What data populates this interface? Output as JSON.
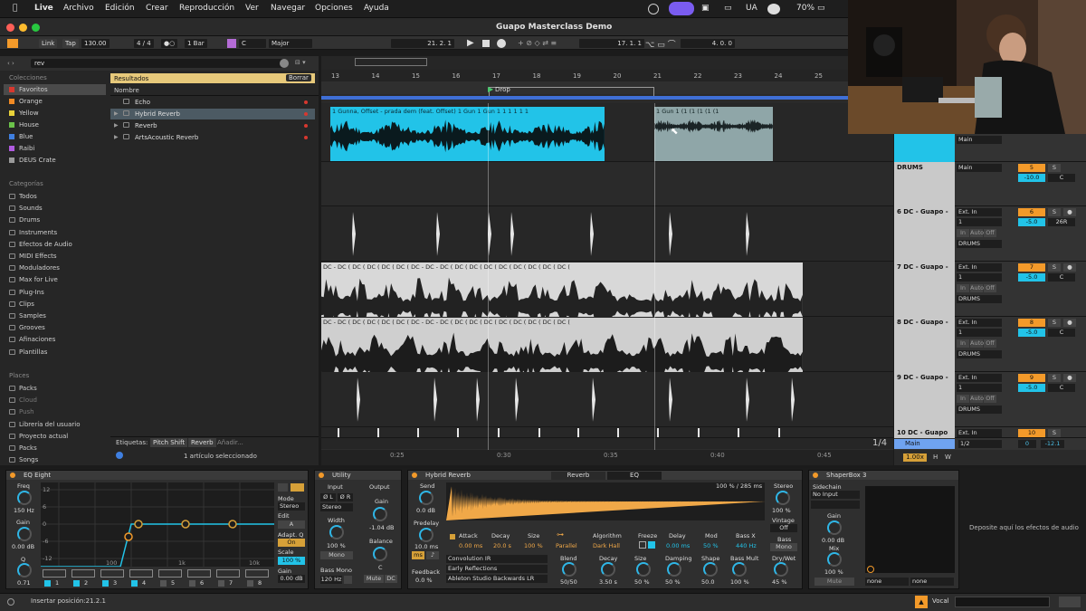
{
  "menubar": {
    "apple": "",
    "app": "Live",
    "items": [
      "Archivo",
      "Edición",
      "Crear",
      "Reproducción",
      "Ver",
      "Navegar",
      "Opciones",
      "Ayuda"
    ],
    "status": {
      "ua": "UA",
      "battery": "70%"
    }
  },
  "window": {
    "title": "Guapo Masterclass Demo"
  },
  "transport": {
    "link": "Link",
    "tap": "Tap",
    "tempo": "130.00",
    "signature": "4 / 4",
    "metro": "●○",
    "quantize": "1 Bar",
    "key": "C",
    "scale": "Major",
    "position": "21.  2.  1",
    "loop_start": "17.  1.  1",
    "loop_len": "4.  0.  0"
  },
  "browser": {
    "search": "rev",
    "collections_title": "Colecciones",
    "collections": [
      {
        "label": "Favoritos",
        "color": "#d8382f"
      },
      {
        "label": "Orange",
        "color": "#f08a24"
      },
      {
        "label": "Yellow",
        "color": "#e8d23a"
      },
      {
        "label": "House",
        "color": "#6bc24a"
      },
      {
        "label": "Blue",
        "color": "#3f7fe0"
      },
      {
        "label": "Raibi",
        "color": "#b05be0"
      },
      {
        "label": "DEUS Crate",
        "color": "#9a9a9a"
      }
    ],
    "categories_title": "Categorías",
    "categories": [
      "Todos",
      "Sounds",
      "Drums",
      "Instruments",
      "Efectos de Audio",
      "MIDI Effects",
      "Moduladores",
      "Max for Live",
      "Plug-Ins",
      "Clips",
      "Samples",
      "Grooves",
      "Afinaciones",
      "Plantillas"
    ],
    "places_title": "Places",
    "places": [
      "Packs",
      "Cloud",
      "Push",
      "Librería del usuario",
      "Proyecto actual",
      "Packs",
      "Songs"
    ],
    "results_title": "Resultados",
    "clear": "Borrar",
    "name_header": "Nombre",
    "results": [
      "Echo",
      "Hybrid Reverb",
      "Reverb",
      "ArtsAcoustic Reverb"
    ],
    "tags_label": "Etiquetas:",
    "tags": [
      "Pitch Shift",
      "Reverb",
      "Añadir..."
    ],
    "selection": "1 artículo seleccionado"
  },
  "arrangement": {
    "ruler": [
      "13",
      "14",
      "15",
      "16",
      "17",
      "18",
      "19",
      "20",
      "21",
      "22",
      "23",
      "24",
      "25"
    ],
    "locator": "Drop",
    "time_ruler": [
      "0:25",
      "0:30",
      "0:35",
      "0:40",
      "0:45"
    ],
    "zoom": "1/4",
    "clip_vocal": "1  Gunna, Offset - prada dem (feat. Offset)  1  Gun 1  Gun 1  1  1  1  1  1",
    "clip_vocal2": "1  Gun 1  (1  (1  (1  (1  (1",
    "clip_dc": "DC - DC ( DC ( DC ( DC ( DC ( DC - DC - DC ( DC ( DC ( DC ( DC ( DC ( DC ( DC ( DC ("
  },
  "tracks": [
    {
      "name": "",
      "io": "Main",
      "num": "",
      "vol": ""
    },
    {
      "name": "DRUMS",
      "io": "Main",
      "num": "5",
      "vol": "-10.0",
      "pan": "C"
    },
    {
      "name": "6 DC - Guapo -",
      "io": "Ext. In",
      "ch": "1",
      "mon": [
        "In",
        "Auto",
        "Off"
      ],
      "out": "DRUMS",
      "num": "6",
      "vol": "-5.0",
      "pan": "26R"
    },
    {
      "name": "7 DC - Guapo -",
      "io": "Ext. In",
      "ch": "1",
      "mon": [
        "In",
        "Auto",
        "Off"
      ],
      "out": "DRUMS",
      "num": "7",
      "vol": "-5.0",
      "pan": "C"
    },
    {
      "name": "8 DC - Guapo -",
      "io": "Ext. In",
      "ch": "1",
      "mon": [
        "In",
        "Auto",
        "Off"
      ],
      "out": "DRUMS",
      "num": "8",
      "vol": "-5.0",
      "pan": "C"
    },
    {
      "name": "9 DC - Guapo -",
      "io": "Ext. In",
      "ch": "1",
      "mon": [
        "In",
        "Auto",
        "Off"
      ],
      "out": "DRUMS",
      "num": "9",
      "vol": "-5.0",
      "pan": "C"
    },
    {
      "name": "10 DC - Guapo",
      "io": "Ext. In",
      "num": "10",
      "vol": "0",
      "pan": "-12.1"
    }
  ],
  "master": {
    "name": "Main",
    "io": "1/2",
    "zoom": "1.00x",
    "h": "H",
    "w": "W"
  },
  "eq": {
    "title": "EQ Eight",
    "freq_label": "Freq",
    "freq": "150 Hz",
    "gain_label": "Gain",
    "gain": "0.00 dB",
    "q_label": "Q",
    "q": "0.71",
    "yaxis": [
      "12",
      "6",
      "0",
      "-6",
      "-12"
    ],
    "xaxis": [
      "100",
      "1k",
      "10k"
    ],
    "mode_label": "Mode",
    "mode": "Stereo",
    "edit": "Edit",
    "edit_a": "A",
    "adapt": "Adapt. Q",
    "on": "On",
    "scale_label": "Scale",
    "scale": "100 %",
    "out_gain_label": "Gain",
    "out_gain": "0.00 dB",
    "bands": [
      "1",
      "2",
      "3",
      "4",
      "5",
      "6",
      "7",
      "8"
    ]
  },
  "utility": {
    "title": "Utility",
    "input": "Input",
    "output": "Output",
    "phase_l": "Ø L",
    "phase_r": "Ø R",
    "channel": "Stereo",
    "width_label": "Width",
    "width": "100 %",
    "mono": "Mono",
    "bass_mono": "Bass Mono",
    "bass_freq": "120 Hz",
    "gain_label": "Gain",
    "gain": "-1.04 dB",
    "balance": "Balance",
    "balance_val": "C",
    "mute": "Mute",
    "dc": "DC"
  },
  "reverb": {
    "title": "Hybrid Reverb",
    "tabs": [
      "Reverb",
      "EQ"
    ],
    "send_label": "Send",
    "send": "0.0 dB",
    "predelay_label": "Predelay",
    "predelay": "10.0 ms",
    "ms": "ms",
    "ir_time": "100 % / 285 ms",
    "attack_label": "Attack",
    "attack": "0.00 ms",
    "decay_label": "Decay",
    "decay": "20.0 s",
    "size_label": "Size",
    "size": "100 %",
    "routing": "Parallel",
    "algo_label": "Algorithm",
    "algo": "Dark Hall",
    "freeze": "Freeze",
    "delay_label": "Delay",
    "delay": "0.00 ms",
    "mod_label": "Mod",
    "mod": "50 %",
    "bassx_label": "Bass X",
    "bassx": "440 Hz",
    "conv": "Convolution IR",
    "ir_cat": "Early Reflections",
    "ir_name": "Ableton Studio Backwards LR",
    "feedback_label": "Feedback",
    "feedback": "0.0 %",
    "blend_label": "Blend",
    "blend": "50/50",
    "decay2_label": "Decay",
    "decay2": "3.50 s",
    "size2_label": "Size",
    "size2": "50 %",
    "damping_label": "Damping",
    "damping": "50 %",
    "shape_label": "Shape",
    "shape": "50.0",
    "bassmult_label": "Bass Mult",
    "bassmult": "100 %",
    "drywet_label": "Dry/Wet",
    "drywet": "45 %",
    "stereo_label": "Stereo",
    "stereo": "100 %",
    "vintage_label": "Vintage",
    "vintage": "Off",
    "bass_label": "Bass",
    "bass": "Mono"
  },
  "shaper": {
    "title": "ShaperBox 3",
    "sidechain": "Sidechain",
    "sc_input": "No Input",
    "gain_label": "Gain",
    "gain": "0.00 dB",
    "mix_label": "Mix",
    "mix": "100 %",
    "mute": "Mute",
    "none1": "none",
    "none2": "none"
  },
  "drop_hint": "Deposite aquí los efectos de audio",
  "status": {
    "insert": "Insertar posición:21.2.1",
    "track": "Vocal"
  }
}
